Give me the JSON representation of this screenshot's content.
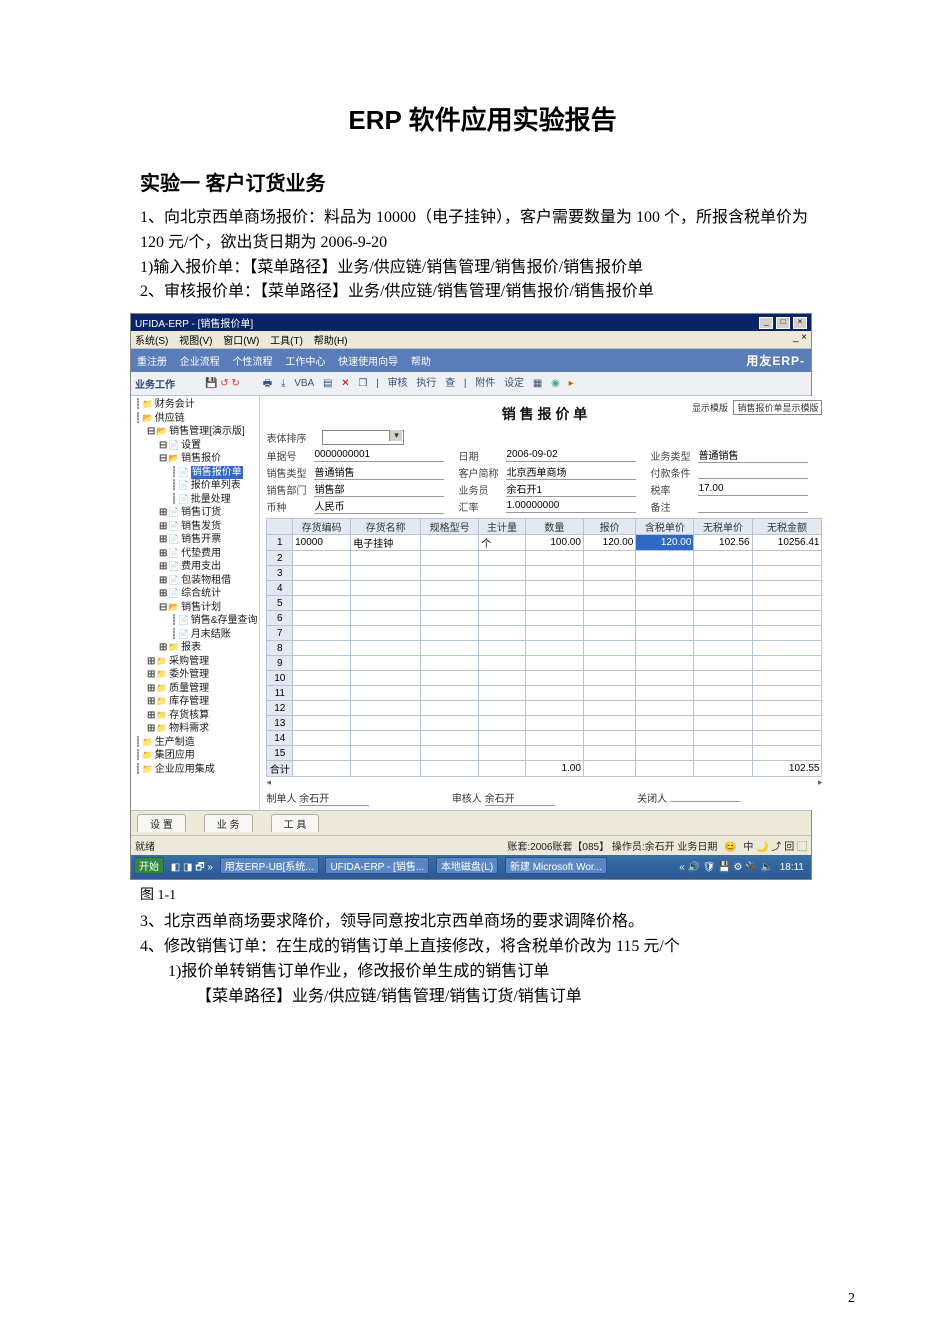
{
  "doc": {
    "title": "ERP 软件应用实验报告",
    "section1": "实验一  客户订货业务",
    "p1": "1、向北京西单商场报价：料品为 10000（电子挂钟），客户需要数量为 100 个，所报含税单价为 120 元/个，欲出货日期为 2006-9-20",
    "p2": "1)输入报价单：【菜单路径】业务/供应链/销售管理/销售报价/销售报价单",
    "p3": "2、审核报价单：【菜单路径】业务/供应链/销售管理/销售报价/销售报价单",
    "fig": "图 1-1",
    "p4": "3、北京西单商场要求降价，领导同意按北京西单商场的要求调降价格。",
    "p5": "4、修改销售订单：在生成的销售订单上直接修改，将含税单价改为 115 元/个",
    "p6": "1)报价单转销售订单作业，修改报价单生成的销售订单",
    "p7": "【菜单路径】业务/供应链/销售管理/销售订货/销售订单",
    "pageno": "2"
  },
  "erp": {
    "title": "UFIDA-ERP - [销售报价单]",
    "menu": [
      "系统(S)",
      "视图(V)",
      "窗口(W)",
      "工具(T)",
      "帮助(H)"
    ],
    "wctl": [
      "_",
      "□",
      "×"
    ],
    "bluebar": [
      "重注册",
      "企业流程",
      "个性流程",
      "工作中心",
      "快速使用向导",
      "帮助"
    ],
    "brand": "用友ERP-",
    "tb2_label": "业务工作",
    "tb2_icons": [
      "打印",
      "输出",
      "VBA",
      "",
      "X",
      "",
      "",
      "审核",
      "执行",
      "查",
      "附件",
      "设定",
      "",
      ""
    ],
    "tree": [
      {
        "lvl": 1,
        "exp": "",
        "ico": "fy",
        "txt": "财务会计"
      },
      {
        "lvl": 1,
        "exp": "",
        "ico": "fo",
        "txt": "供应链"
      },
      {
        "lvl": 2,
        "exp": "-",
        "ico": "fo",
        "txt": "销售管理[演示版]"
      },
      {
        "lvl": 3,
        "exp": "-",
        "ico": "doc",
        "txt": "设置"
      },
      {
        "lvl": 3,
        "exp": "-",
        "ico": "fo",
        "txt": "销售报价"
      },
      {
        "lvl": 4,
        "exp": "",
        "ico": "doc",
        "txt": "销售报价单",
        "sel": true
      },
      {
        "lvl": 4,
        "exp": "",
        "ico": "doc",
        "txt": "报价单列表"
      },
      {
        "lvl": 4,
        "exp": "",
        "ico": "doc",
        "txt": "批量处理"
      },
      {
        "lvl": 3,
        "exp": "+",
        "ico": "doc",
        "txt": "销售订货"
      },
      {
        "lvl": 3,
        "exp": "+",
        "ico": "doc",
        "txt": "销售发货"
      },
      {
        "lvl": 3,
        "exp": "+",
        "ico": "doc",
        "txt": "销售开票"
      },
      {
        "lvl": 3,
        "exp": "+",
        "ico": "doc",
        "txt": "代垫费用"
      },
      {
        "lvl": 3,
        "exp": "+",
        "ico": "doc",
        "txt": "费用支出"
      },
      {
        "lvl": 3,
        "exp": "+",
        "ico": "doc",
        "txt": "包装物租借"
      },
      {
        "lvl": 3,
        "exp": "+",
        "ico": "doc",
        "txt": "综合统计"
      },
      {
        "lvl": 3,
        "exp": "-",
        "ico": "fo",
        "txt": "销售计划"
      },
      {
        "lvl": 4,
        "exp": "",
        "ico": "doc",
        "txt": "销售&存量查询"
      },
      {
        "lvl": 4,
        "exp": "",
        "ico": "doc",
        "txt": "月末结账"
      },
      {
        "lvl": 3,
        "exp": "+",
        "ico": "fy",
        "txt": "报表"
      },
      {
        "lvl": 2,
        "exp": "+",
        "ico": "fy",
        "txt": "采购管理"
      },
      {
        "lvl": 2,
        "exp": "+",
        "ico": "fy",
        "txt": "委外管理"
      },
      {
        "lvl": 2,
        "exp": "+",
        "ico": "fy",
        "txt": "质量管理"
      },
      {
        "lvl": 2,
        "exp": "+",
        "ico": "fy",
        "txt": "库存管理"
      },
      {
        "lvl": 2,
        "exp": "+",
        "ico": "fy",
        "txt": "存货核算"
      },
      {
        "lvl": 2,
        "exp": "+",
        "ico": "fy",
        "txt": "物料需求"
      },
      {
        "lvl": 1,
        "exp": "",
        "ico": "fy",
        "txt": "生产制造"
      },
      {
        "lvl": 1,
        "exp": "",
        "ico": "fy",
        "txt": "集团应用"
      },
      {
        "lvl": 1,
        "exp": "",
        "ico": "fy",
        "txt": "企业应用集成"
      }
    ],
    "form": {
      "title": "销 售 报 价 单",
      "template_label": "显示模版",
      "template_value": "销售报价单显示模版",
      "sort_label": "表体排序",
      "fields": {
        "no_l": "单据号",
        "no_v": "0000000001",
        "date_l": "日期",
        "date_v": "2006-09-02",
        "biz_l": "业务类型",
        "biz_v": "普通销售",
        "st_l": "销售类型",
        "st_v": "普通销售",
        "cust_l": "客户简称",
        "cust_v": "北京西单商场",
        "pay_l": "付款条件",
        "pay_v": "",
        "dept_l": "销售部门",
        "dept_v": "销售部",
        "per_l": "业务员",
        "per_v": "余石开1",
        "tax_l": "税率",
        "tax_v": "17.00",
        "cur_l": "币种",
        "cur_v": "人民币",
        "rate_l": "汇率",
        "rate_v": "1.00000000",
        "rem_l": "备注",
        "rem_v": ""
      },
      "cols": [
        "",
        "存货编码",
        "存货名称",
        "规格型号",
        "主计量",
        "数量",
        "报价",
        "含税单价",
        "无税单价",
        "无税金额"
      ],
      "row1": [
        "1",
        "10000",
        "电子挂钟",
        "",
        "个",
        "100.00",
        "120.00",
        "120.00",
        "102.56",
        "10256.41"
      ],
      "sum_label": "合计",
      "sum_qty": "1.00",
      "sum_amt": "102.55",
      "maker_l": "制单人",
      "maker_v": "余石开",
      "checker_l": "审核人",
      "checker_v": "余石开",
      "closer_l": "关闭人",
      "closer_v": ""
    },
    "tabs": [
      "设 置",
      "业 务",
      "工 具"
    ],
    "status_left": "就绪",
    "status_right": "账套:2006账套【085】   操作员:余石开  业务日期",
    "taskbar_left": [
      "开始",
      "",
      "",
      "",
      "",
      "用友ERP-UB[系统...",
      "UFIDA-ERP - [销售...",
      "本地磁盘(L)",
      "新建 Microsoft Wor..."
    ],
    "taskbar_right": "18:11"
  }
}
